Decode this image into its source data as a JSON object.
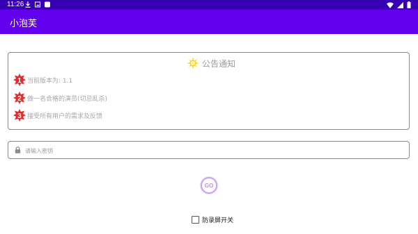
{
  "status_bar": {
    "time": "11:26",
    "left_icons": [
      "download-icon",
      "image-icon",
      "app-icon"
    ],
    "right_icons": [
      "wifi-icon",
      "signal-icon",
      "battery-icon"
    ]
  },
  "app_bar": {
    "title": "小泡芙"
  },
  "notice": {
    "title": "公告通知",
    "title_icon": "sun-icon",
    "items": [
      {
        "number": "1",
        "text": "当前版本为: 1.1"
      },
      {
        "number": "2",
        "text": "做一名合格的演员(切忌乱杀)"
      },
      {
        "number": "3",
        "text": "接受所有用户的需求及反馈"
      }
    ]
  },
  "key_input": {
    "placeholder": "请输入密钥",
    "value": "",
    "icon": "lock-icon"
  },
  "go_button": {
    "label": "GO"
  },
  "anti_record": {
    "label": "防录屏开关",
    "checked": false
  },
  "colors": {
    "status_bar": "#3700b3",
    "app_bar": "#6200ee",
    "badge_red": "#e52a2a",
    "go_accent": "#b98ee9"
  }
}
